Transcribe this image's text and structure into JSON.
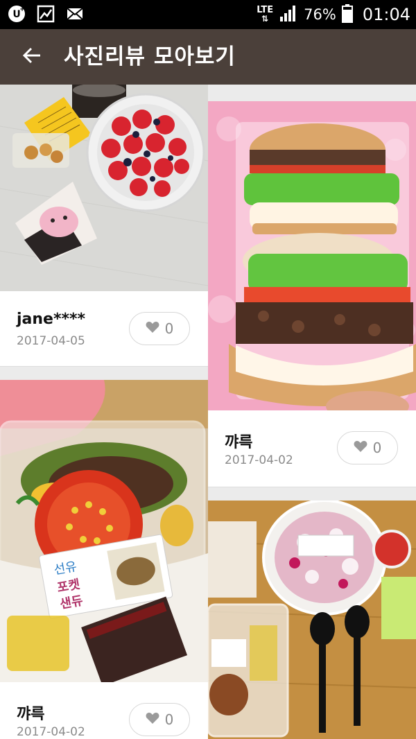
{
  "status_bar": {
    "network": "LTE",
    "battery": "76%",
    "time": "01:04",
    "icons": [
      "u-plus-icon",
      "gallery-icon",
      "mail-icon",
      "lte-arrows-icon",
      "signal-icon",
      "battery-icon"
    ]
  },
  "app_bar": {
    "title": "사진리뷰 모아보기",
    "back_icon": "arrow-left-icon"
  },
  "reviews": [
    {
      "author": "jane****",
      "date": "2017-04-05",
      "likes": "0",
      "photo": "strawberry-cake-photo"
    },
    {
      "author": "꺄륵",
      "date": "2017-04-02",
      "likes": "0",
      "photo": "bulgogi-burger-photo"
    },
    {
      "author": "꺄륵",
      "date": "2017-04-02",
      "likes": "0",
      "photo": "pocket-sandwich-photo",
      "label_lines": [
        "선유",
        "포켓",
        "샌듀"
      ]
    },
    {
      "author": "",
      "date": "",
      "likes": "",
      "photo": "takeout-meal-photo"
    }
  ],
  "colors": {
    "app_bar": "#4b403a",
    "status_bar": "#000000",
    "background": "#ebebeb",
    "date_text": "#8a8a8a",
    "heart": "#9a9a9a"
  }
}
